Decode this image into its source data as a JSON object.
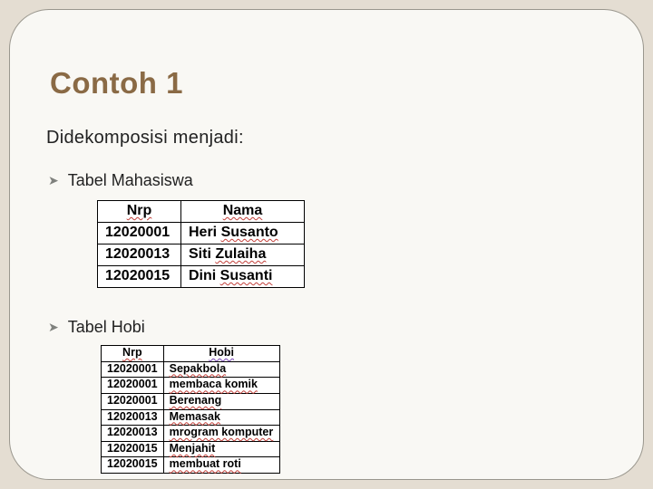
{
  "title": "Contoh 1",
  "subtitle": "Didekomposisi menjadi:",
  "bullets": {
    "mahasiswa": "Tabel Mahasiswa",
    "hobi": "Tabel Hobi"
  },
  "table_mahasiswa": {
    "headers": {
      "nrp": "Nrp",
      "nama": "Nama"
    },
    "rows": [
      {
        "nrp": "12020001",
        "nama_pre": "Heri ",
        "nama_sq": "Susanto"
      },
      {
        "nrp": "12020013",
        "nama_pre": "Siti ",
        "nama_sq": "Zulaiha"
      },
      {
        "nrp": "12020015",
        "nama_pre": "Dini ",
        "nama_sq": "Susanti"
      }
    ]
  },
  "table_hobi": {
    "headers": {
      "nrp": "Nrp",
      "hobi": "Hobi"
    },
    "rows": [
      {
        "nrp": "12020001",
        "hobi": "Sepakbola"
      },
      {
        "nrp": "12020001",
        "hobi": "membaca komik"
      },
      {
        "nrp": "12020001",
        "hobi": "Berenang"
      },
      {
        "nrp": "12020013",
        "hobi": "Memasak"
      },
      {
        "nrp": "12020013",
        "hobi": "mrogram komputer"
      },
      {
        "nrp": "12020015",
        "hobi": "Menjahit"
      },
      {
        "nrp": "12020015",
        "hobi": "membuat roti"
      }
    ]
  }
}
